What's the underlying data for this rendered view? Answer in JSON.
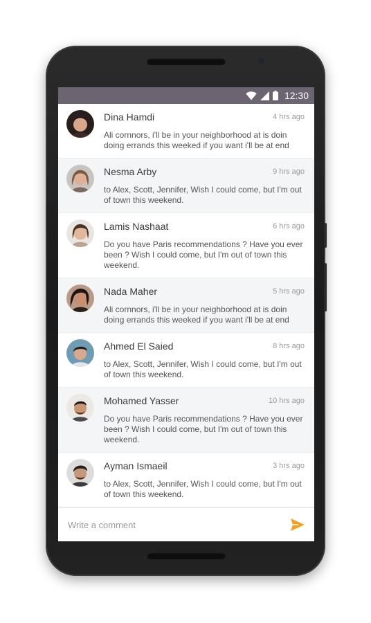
{
  "status_bar": {
    "time": "12:30"
  },
  "messages": [
    {
      "name": "Dina Hamdi",
      "time": "4 hrs ago",
      "text": "Ali cornnors, i'll be in your neighborhood at is doin doing errands this weeked if you want i'll be at end"
    },
    {
      "name": "Nesma Arby",
      "time": "9 hrs ago",
      "text": "to Alex, Scott, Jennifer, Wish I could come, but I'm out of town this weekend."
    },
    {
      "name": "Lamis Nashaat",
      "time": "6 hrs ago",
      "text": "Do you have Paris recommendations ? Have you ever been ? Wish I could come, but I'm out of town this weekend."
    },
    {
      "name": "Nada Maher",
      "time": "5 hrs ago",
      "text": "Ali cornnors, i'll be in your neighborhood at is doin doing errands this weeked if you want i'll be at end"
    },
    {
      "name": "Ahmed El Saied",
      "time": "8 hrs ago",
      "text": "to Alex, Scott, Jennifer, Wish I could come, but I'm out of town this weekend."
    },
    {
      "name": "Mohamed Yasser",
      "time": "10 hrs ago",
      "text": "Do you have Paris recommendations ? Have you ever been ? Wish I could come, but I'm out of town this weekend."
    },
    {
      "name": "Ayman Ismaeil",
      "time": "3 hrs ago",
      "text": "to Alex, Scott, Jennifer, Wish I could come, but I'm out of town this weekend."
    }
  ],
  "composer": {
    "placeholder": "Write a comment"
  },
  "colors": {
    "status_bar": "#6c6470",
    "accent": "#f5a023",
    "alt_row": "#f4f5f7"
  }
}
